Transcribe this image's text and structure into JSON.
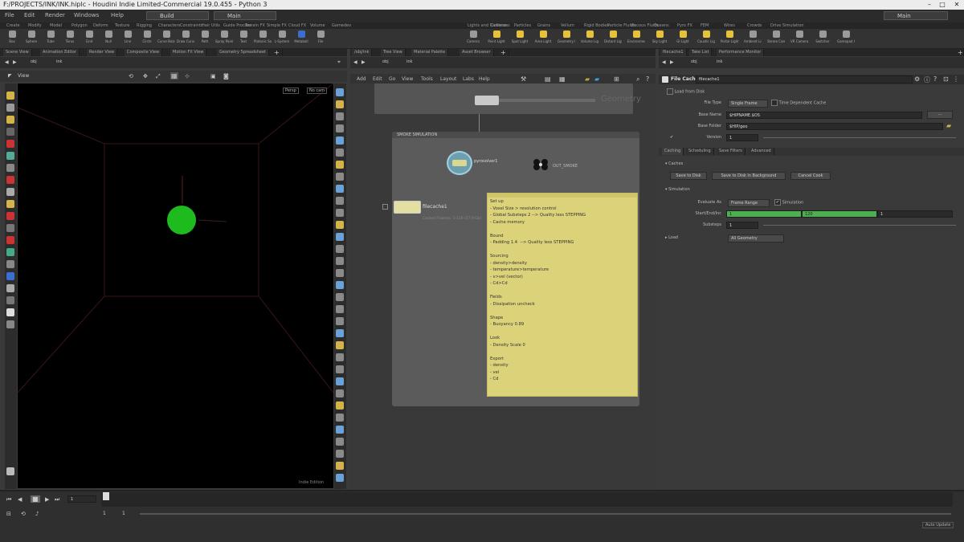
{
  "window": {
    "title": "F:/PROJECTS/INK/INK.hiplc - Houdini Indie Limited-Commercial 19.0.455 - Python 3"
  },
  "menu": {
    "items": [
      "File",
      "Edit",
      "Render",
      "Windows",
      "Help"
    ],
    "desktop": "Build",
    "main": "Main",
    "right_menu": "Main"
  },
  "shelf": {
    "tabs_left": [
      "Create",
      "Modify",
      "Model",
      "Polygon",
      "Deform",
      "Texture",
      "Rigging",
      "Characters",
      "Constraints",
      "Hair Utils",
      "Guide Process",
      "Terrain FX",
      "Simple FX",
      "Cloud FX",
      "Volume",
      "Gamedev"
    ],
    "tabs_right": [
      "Lights and Cameras",
      "Collisions",
      "Particles",
      "Grains",
      "Vellum",
      "Rigid Bodies",
      "Particle Fluids",
      "Viscous Fluids",
      "Oceans",
      "Pyro FX",
      "FEM",
      "Wires",
      "Crowds",
      "Drive Simulation"
    ],
    "tools_left": [
      "Box",
      "Sphere",
      "Tube",
      "Torus",
      "Grid",
      "Null",
      "Line",
      "Circle",
      "Curve Bezier",
      "Draw Curve",
      "Path",
      "Spray Paint",
      "Text",
      "Platonic Solids",
      "L-System",
      "Metaball",
      "File"
    ],
    "tools_right": [
      "Camera",
      "Point Light",
      "Spot Light",
      "Area Light",
      "Geometry Light",
      "Volume Light",
      "Distant Light",
      "Environment Light",
      "Sky Light",
      "GI Light",
      "Caustic Light",
      "Portal Light",
      "Ambient Light",
      "Stereo Camera",
      "VR Camera",
      "Switcher",
      "Gamepad Camera"
    ]
  },
  "viewer": {
    "tabs": [
      "Scene View",
      "Animation Editor",
      "Render View",
      "Composite View",
      "Motion FX View",
      "Geometry Spreadsheet"
    ],
    "path": "obj",
    "path_node": "ink",
    "label": "View",
    "persp": "Persp",
    "cam": "No cam",
    "footer": "Indie Edition"
  },
  "network": {
    "tabs": [
      "/obj/ink",
      "Tree View",
      "Material Palette",
      "Asset Browser"
    ],
    "path": "obj",
    "path_node": "ink",
    "menu": [
      "Add",
      "Edit",
      "Go",
      "View",
      "Tools",
      "Layout",
      "Labs",
      "Help"
    ],
    "context": "Geometry",
    "network_box": "SMOKE SIMULATION",
    "nodes": {
      "pyrosolver": "pyrosolver1",
      "out": "OUT_SMOKE",
      "cache": "filecache1",
      "cache_info": "Cached Frames: 1-120 (27.9 Gb)"
    },
    "sticky_title": "Notes",
    "sticky_lines": [
      "Set up",
      "- Voxel Size > resolution control",
      "- Global Substeps 2 --> Quality less STEPPING",
      "- Cache memory",
      "",
      "Bound",
      "- Padding 1.4  --> Quality less STEPPING",
      "",
      "Sourcing",
      "- density>density",
      "- temperature>temperature",
      "- v>vel (vector)",
      "- Cd>Cd",
      "",
      "Fields",
      "- Dissipation uncheck",
      "",
      "Shape",
      "- Buoyancy 0.89",
      "",
      "Look",
      "- Density Scale 0",
      "",
      "Export",
      "- density",
      "- vel",
      "- Cd"
    ]
  },
  "params": {
    "tabs": [
      "filecache1",
      "Take List",
      "Performance Monitor"
    ],
    "path": "obj",
    "path_node": "ink",
    "node_type": "File Cache",
    "node_name": "filecache1",
    "load_from_disk": "Load from Disk",
    "file_type_label": "File Type",
    "file_type": "Single Frame",
    "timedep_label": "Time Dependent Cache",
    "base_name_label": "Base Name",
    "base_name": "$HIPNAME.$OS",
    "base_folder_label": "Base Folder",
    "base_folder": "$HIP/geo",
    "version_label": "Version",
    "version": "1",
    "subtabs": [
      "Caching",
      "Scheduling",
      "Save Filters",
      "Advanced"
    ],
    "caches_header": "Caches",
    "buttons": [
      "Save to Disk",
      "Save to Disk in Background",
      "Cancel Cook"
    ],
    "sim_header": "Simulation",
    "evaluate_label": "Evaluate As",
    "evaluate": "Frame Range",
    "simulation_check": "Simulation",
    "start_end_label": "Start/End/Inc",
    "start": "1",
    "end": "120",
    "inc": "1",
    "substeps_label": "Substeps",
    "substeps": "1",
    "load_label": "Load",
    "load_value": "All Geometry",
    "watch_menu": "Watch"
  },
  "timeline": {
    "frame": "1",
    "start": "1",
    "end": "1",
    "status": "Auto Update"
  }
}
